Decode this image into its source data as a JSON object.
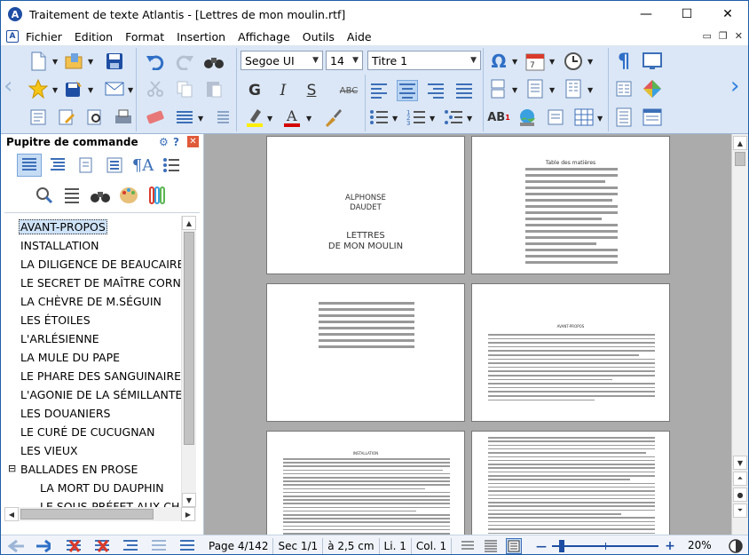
{
  "window": {
    "title": "Traitement de texte Atlantis - [Lettres de mon moulin.rtf]",
    "app_icon_letter": "A",
    "minimize": "—",
    "maximize": "☐",
    "close": "✕"
  },
  "menubar": {
    "items": [
      "Fichier",
      "Edition",
      "Format",
      "Insertion",
      "Affichage",
      "Outils",
      "Aide"
    ],
    "mdi_minimize": "▭",
    "mdi_restore": "❐",
    "mdi_close": "✕"
  },
  "toolbar": {
    "font_name": "Segoe UI",
    "font_size": "14",
    "style": "Titre 1",
    "colors": {
      "accent": "#1e4ea3",
      "toolbar_bg": "#dbe7f6",
      "highlight": "#ffee00",
      "font_color": "#d40000"
    }
  },
  "side_panel": {
    "title": "Pupitre de commande",
    "toc": [
      "AVANT-PROPOS",
      "INSTALLATION",
      "LA DILIGENCE DE BEAUCAIRE",
      "LE SECRET DE MAÎTRE CORNILLE",
      "LA CHÈVRE DE M.SÉGUIN",
      "LES ÉTOILES",
      "L'ARLÉSIENNE",
      "LA MULE DU PAPE",
      "LE PHARE DES SANGUINAIRES",
      "L'AGONIE DE LA SÉMILLANTE",
      "LES DOUANIERS",
      "LE CURÉ DE CUCUGNAN",
      "LES VIEUX",
      "BALLADES EN PROSE",
      "LA MORT DU DAUPHIN",
      "LE SOUS-PRÉFET AUX CHAMPS"
    ],
    "collapse_toggle": "⊟"
  },
  "document": {
    "page1": {
      "author_line1": "ALPHONSE",
      "author_line2": "DAUDET",
      "title_line1": "LETTRES",
      "title_line2": "DE MON MOULIN"
    },
    "page2_heading": "Table des matières",
    "page4_heading": "AVANT-PROPOS",
    "page5_heading": "INSTALLATION"
  },
  "statusbar": {
    "page": "Page 4/142",
    "section": "Sec 1/1",
    "position": "à 2,5 cm",
    "line": "Li. 1",
    "column": "Col. 1",
    "zoom": "20%",
    "zoom_minus": "—",
    "zoom_plus": "+"
  }
}
